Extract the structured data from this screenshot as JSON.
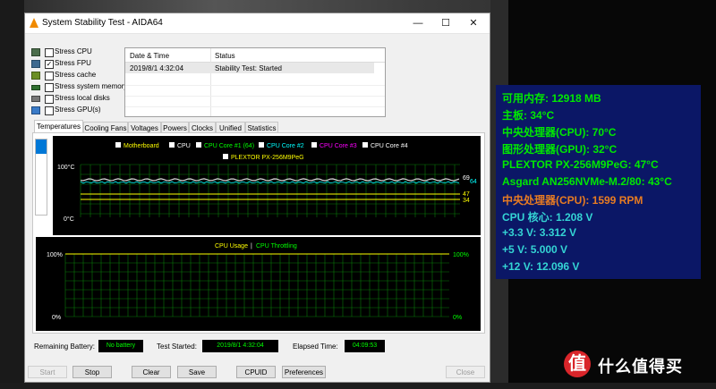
{
  "window": {
    "title": "System Stability Test - AIDA64",
    "controls": {
      "minimize": "—",
      "maximize": "☐",
      "close": "✕"
    }
  },
  "stress_options": [
    {
      "label": "Stress CPU",
      "checked": false,
      "icon": "cpu-icon"
    },
    {
      "label": "Stress FPU",
      "checked": true,
      "icon": "fpu-icon"
    },
    {
      "label": "Stress cache",
      "checked": false,
      "icon": "cache-icon"
    },
    {
      "label": "Stress system memory",
      "checked": false,
      "icon": "memory-icon"
    },
    {
      "label": "Stress local disks",
      "checked": false,
      "icon": "disk-icon"
    },
    {
      "label": "Stress GPU(s)",
      "checked": false,
      "icon": "gpu-icon"
    }
  ],
  "log": {
    "headers": [
      "Date & Time",
      "Status"
    ],
    "rows": [
      {
        "datetime": "2019/8/1 4:32:04",
        "status": "Stability Test: Started"
      }
    ]
  },
  "tabs": [
    "Temperatures",
    "Cooling Fans",
    "Voltages",
    "Powers",
    "Clocks",
    "Unified",
    "Statistics"
  ],
  "active_tab": "Temperatures",
  "temp_chart": {
    "legend_row1": [
      {
        "label": "Motherboard",
        "color": "#ffff00"
      },
      {
        "label": "CPU",
        "color": "#ffffff"
      },
      {
        "label": "CPU Core #1 (64)",
        "color": "#00ff00"
      },
      {
        "label": "CPU Core #2",
        "color": "#00ffff"
      },
      {
        "label": "CPU Core #3",
        "color": "#ff00ff"
      },
      {
        "label": "CPU Core #4",
        "color": "#ffffff"
      }
    ],
    "legend_row2": [
      {
        "label": "PLEXTOR PX-256M9PeG",
        "color": "#ffff00"
      }
    ],
    "ymax_label": "100°C",
    "ymin_label": "0°C",
    "value_labels": [
      "69",
      "64",
      "47",
      "34"
    ]
  },
  "usage_chart": {
    "title_a": "CPU Usage",
    "title_sep": "|",
    "title_b": "CPU Throttling",
    "left_max": "100%",
    "left_min": "0%",
    "right_max": "100%",
    "right_min": "0%"
  },
  "status": {
    "battery_label": "Remaining Battery:",
    "battery_value": "No battery",
    "started_label": "Test Started:",
    "started_value": "2019/8/1 4:32:04",
    "elapsed_label": "Elapsed Time:",
    "elapsed_value": "04:09:53"
  },
  "buttons": {
    "start": "Start",
    "stop": "Stop",
    "clear": "Clear",
    "save": "Save",
    "cpuid": "CPUID",
    "preferences": "Preferences",
    "close": "Close"
  },
  "osd": [
    {
      "text": "可用内存: 12918 MB",
      "color": "green"
    },
    {
      "text": "主板: 34°C",
      "color": "green"
    },
    {
      "text": "中央处理器(CPU): 70°C",
      "color": "green"
    },
    {
      "text": "图形处理器(GPU): 32°C",
      "color": "green"
    },
    {
      "text": "PLEXTOR PX-256M9PeG: 47°C",
      "color": "green"
    },
    {
      "text": "Asgard AN256NVMe-M.2/80: 43°C",
      "color": "green"
    },
    {
      "text": "中央处理器(CPU): 1599 RPM",
      "color": "orange"
    },
    {
      "text": "CPU 核心: 1.208 V",
      "color": "cyan"
    },
    {
      "text": "+3.3 V: 3.312 V",
      "color": "cyan"
    },
    {
      "text": "+5 V: 5.000 V",
      "color": "cyan"
    },
    {
      "text": "+12 V: 12.096 V",
      "color": "cyan"
    }
  ],
  "watermark": {
    "badge": "值",
    "text": "什么值得买"
  }
}
